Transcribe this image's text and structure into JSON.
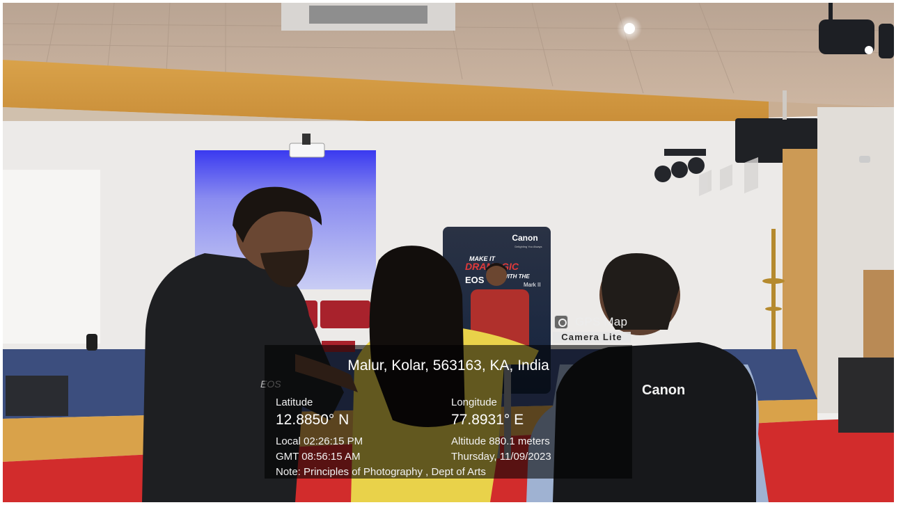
{
  "backdrop": {
    "brand": "Canon",
    "tagline": "Delighting You Always",
    "headline_1": "MAKE IT",
    "headline_2": "DRAMAGIC",
    "headline_3": "WITH THE",
    "model": "EOS",
    "model_suffix": "Mark II"
  },
  "vest_logo": "Canon",
  "jacket_logo": "EOS",
  "overlay": {
    "app_name": "GPS Map",
    "app_edition": "Camera Lite",
    "address": "Malur, Kolar, 563163, KA, India",
    "latitude_label": "Latitude",
    "latitude_value": "12.8850° N",
    "longitude_label": "Longitude",
    "longitude_value": "77.8931° E",
    "local_time": "Local 02:26:15 PM",
    "gmt_time": "GMT 08:56:15 AM",
    "altitude": "Altitude  880.1 meters",
    "date": "Thursday, 11/09/2023",
    "note": "Note: Principles of Photography , Dept of Arts"
  }
}
